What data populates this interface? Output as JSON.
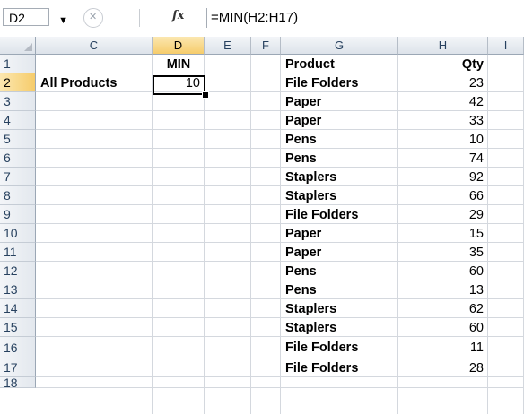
{
  "formula_bar": {
    "name_box": "D2",
    "fx_label": "fx",
    "formula": "=MIN(H2:H17)"
  },
  "columns": [
    "C",
    "D",
    "E",
    "F",
    "G",
    "H",
    "I"
  ],
  "selected_column": "D",
  "selected_row": "2",
  "rows": [
    {
      "num": "1",
      "C": "",
      "D": "MIN",
      "G": "Product",
      "H": "Qty"
    },
    {
      "num": "2",
      "C": "All Products",
      "D": "10",
      "G": "File Folders",
      "H": "23"
    },
    {
      "num": "3",
      "C": "",
      "D": "",
      "G": "Paper",
      "H": "42"
    },
    {
      "num": "4",
      "C": "",
      "D": "",
      "G": "Paper",
      "H": "33"
    },
    {
      "num": "5",
      "C": "",
      "D": "",
      "G": "Pens",
      "H": "10"
    },
    {
      "num": "6",
      "C": "",
      "D": "",
      "G": "Pens",
      "H": "74"
    },
    {
      "num": "7",
      "C": "",
      "D": "",
      "G": "Staplers",
      "H": "92"
    },
    {
      "num": "8",
      "C": "",
      "D": "",
      "G": "Staplers",
      "H": "66"
    },
    {
      "num": "9",
      "C": "",
      "D": "",
      "G": "File Folders",
      "H": "29"
    },
    {
      "num": "10",
      "C": "",
      "D": "",
      "G": "Paper",
      "H": "15"
    },
    {
      "num": "11",
      "C": "",
      "D": "",
      "G": "Paper",
      "H": "35"
    },
    {
      "num": "12",
      "C": "",
      "D": "",
      "G": "Pens",
      "H": "60"
    },
    {
      "num": "13",
      "C": "",
      "D": "",
      "G": "Pens",
      "H": "13"
    },
    {
      "num": "14",
      "C": "",
      "D": "",
      "G": "Staplers",
      "H": "62"
    },
    {
      "num": "15",
      "C": "",
      "D": "",
      "G": "Staplers",
      "H": "60"
    },
    {
      "num": "16",
      "C": "",
      "D": "",
      "G": "File Folders",
      "H": "11"
    },
    {
      "num": "17",
      "C": "",
      "D": "",
      "G": "File Folders",
      "H": "28"
    },
    {
      "num": "18",
      "C": "",
      "D": "",
      "G": "",
      "H": ""
    }
  ]
}
